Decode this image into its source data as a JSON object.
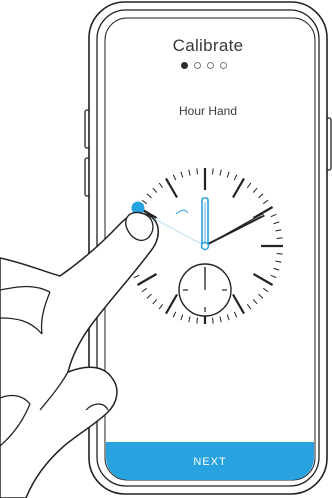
{
  "screen": {
    "title": "Calibrate",
    "subtitle": "Hour Hand",
    "next_label": "NEXT"
  },
  "pager": {
    "total": 4,
    "active_index": 0
  },
  "colors": {
    "accent": "#29a3df",
    "hand_highlight": "#8ec9ee",
    "outline": "#222222"
  },
  "icons": [
    "phone-outline",
    "watch-dial-icon",
    "hand-finger-icon"
  ]
}
